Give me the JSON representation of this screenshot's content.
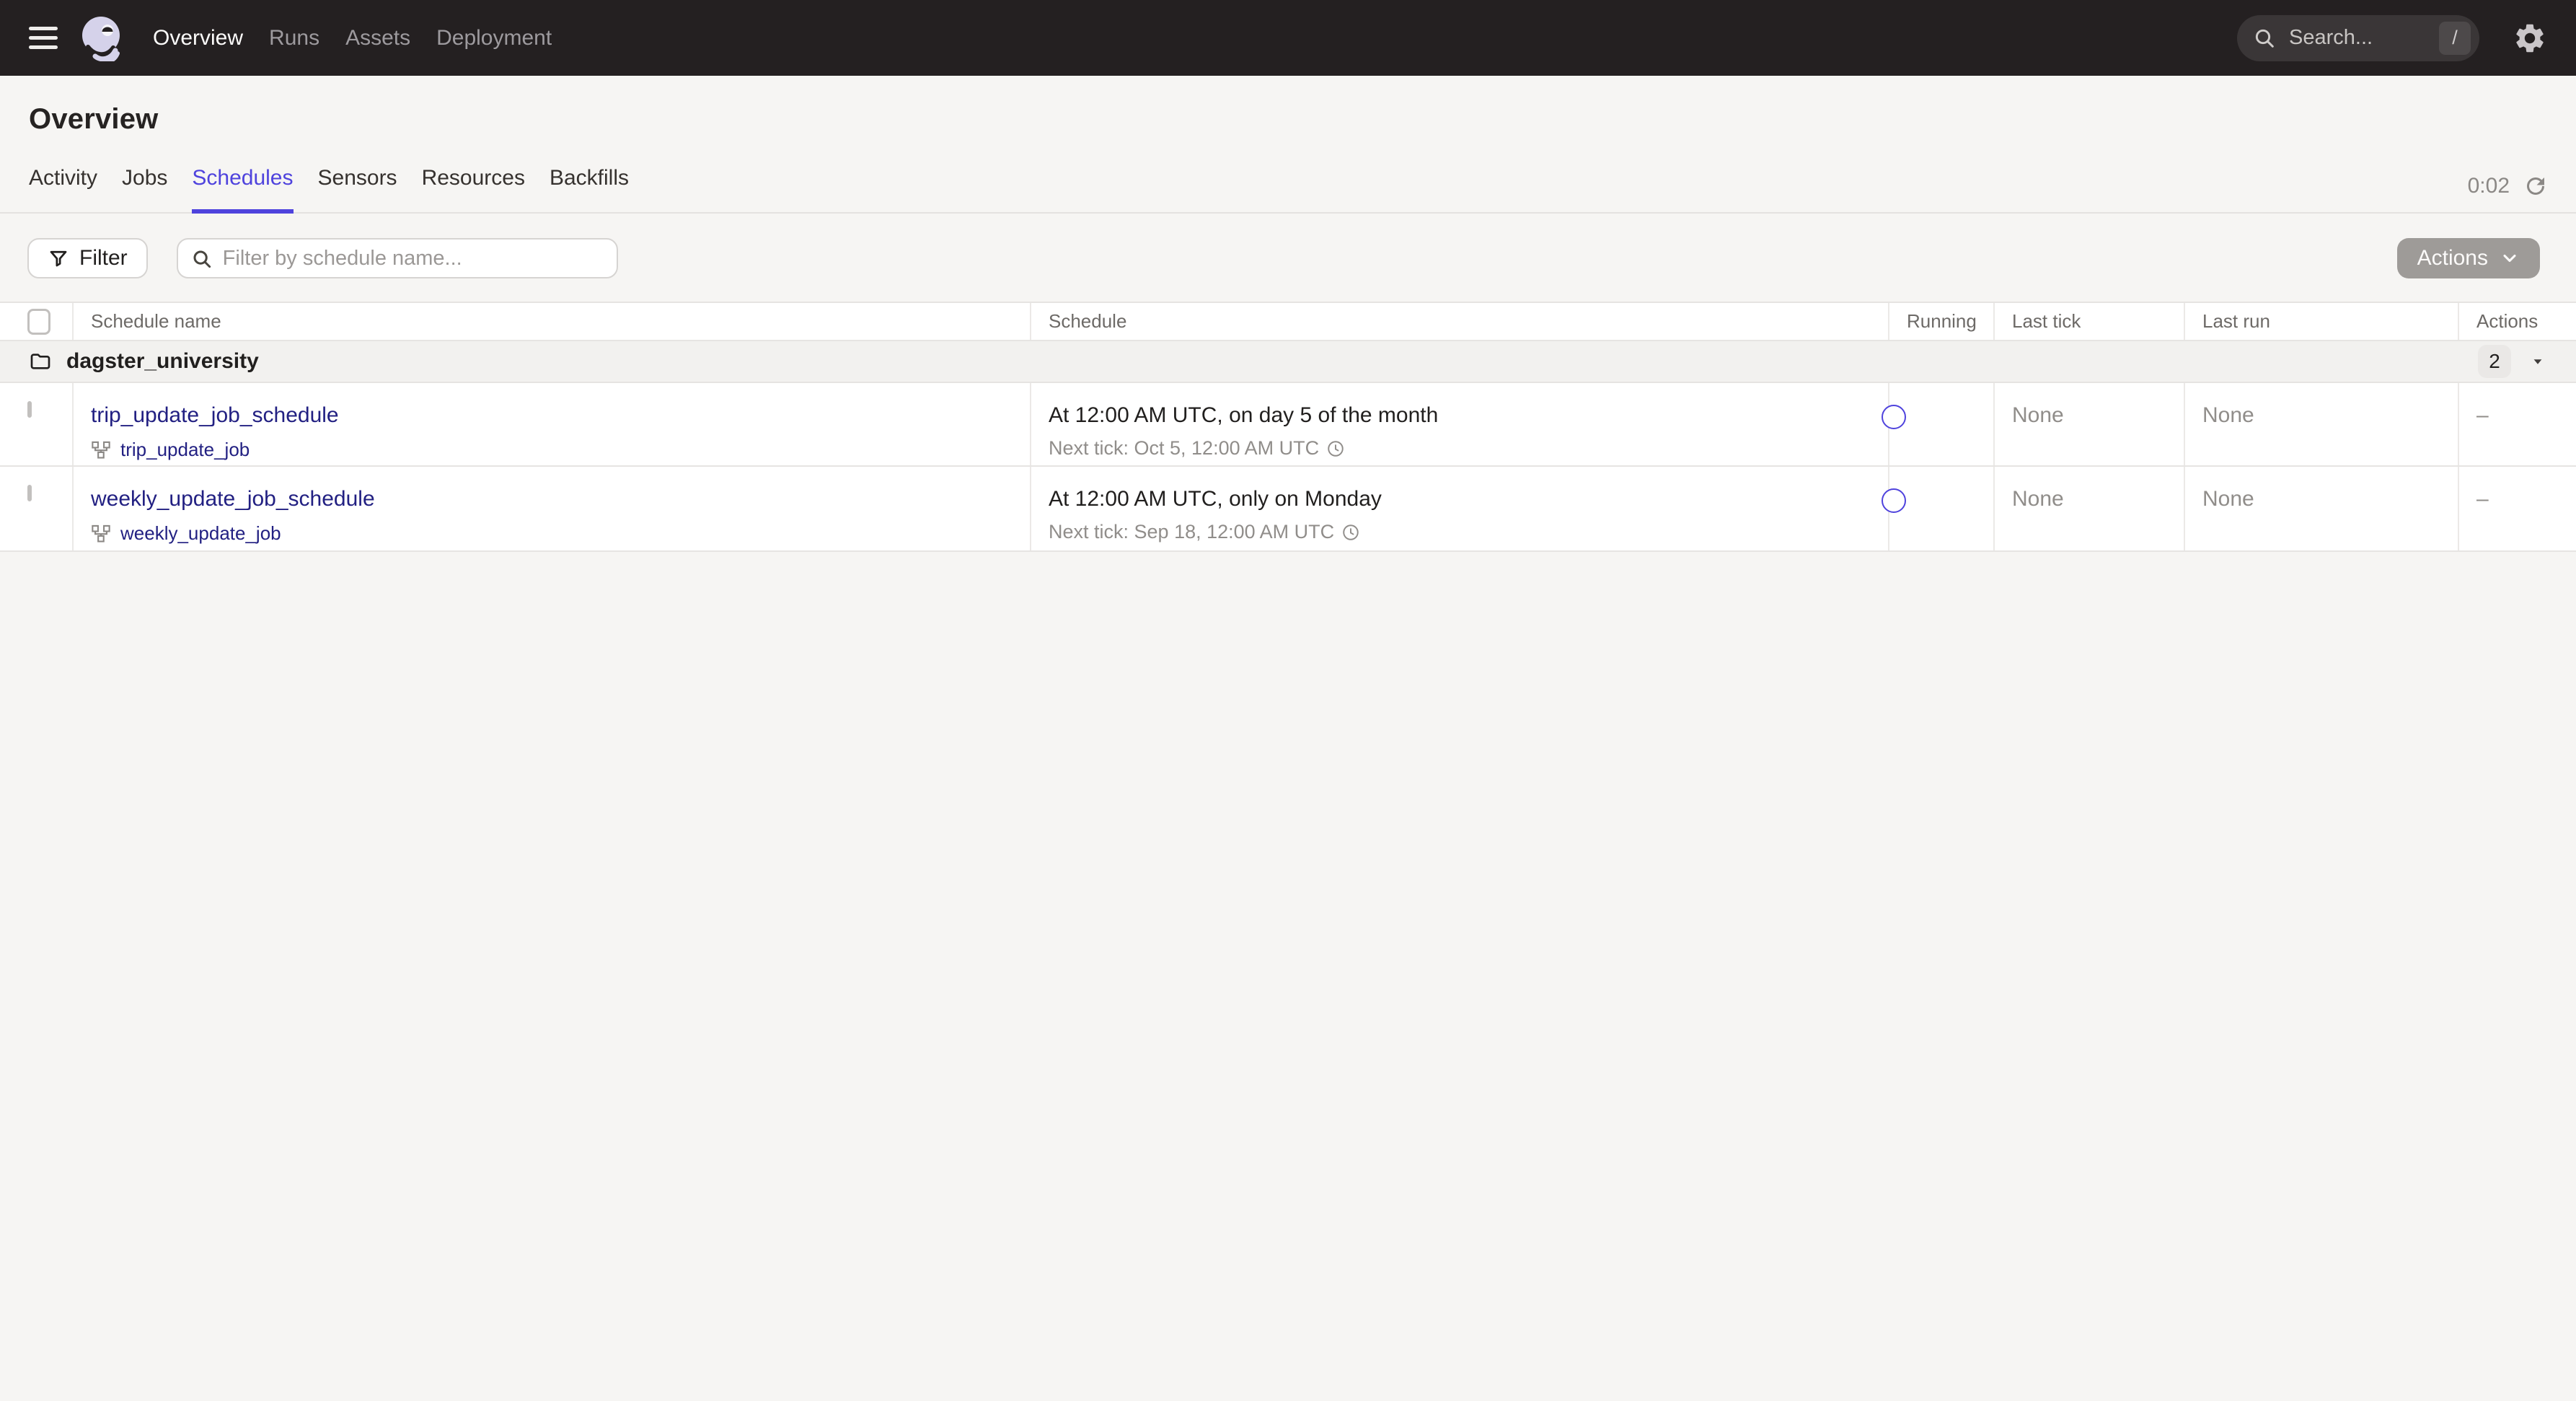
{
  "navbar": {
    "items": [
      {
        "label": "Overview",
        "active": true
      },
      {
        "label": "Runs",
        "active": false
      },
      {
        "label": "Assets",
        "active": false
      },
      {
        "label": "Deployment",
        "active": false
      }
    ],
    "search": {
      "placeholder": "Search...",
      "shortcut": "/"
    }
  },
  "page": {
    "title": "Overview"
  },
  "tabs": {
    "items": [
      {
        "label": "Activity",
        "active": false
      },
      {
        "label": "Jobs",
        "active": false
      },
      {
        "label": "Schedules",
        "active": true
      },
      {
        "label": "Sensors",
        "active": false
      },
      {
        "label": "Resources",
        "active": false
      },
      {
        "label": "Backfills",
        "active": false
      }
    ],
    "refresh_timer": "0:02"
  },
  "toolbar": {
    "filter_label": "Filter",
    "filter_placeholder": "Filter by schedule name...",
    "actions_label": "Actions"
  },
  "table": {
    "columns": [
      "Schedule name",
      "Schedule",
      "Running",
      "Last tick",
      "Last run",
      "Actions"
    ],
    "group": {
      "name": "dagster_university",
      "count": "2"
    },
    "rows": [
      {
        "name": "trip_update_job_schedule",
        "job": "trip_update_job",
        "cron": "At 12:00 AM UTC, on day 5 of the month",
        "next_tick": "Next tick: Oct 5, 12:00 AM UTC",
        "running": true,
        "last_tick": "None",
        "last_run": "None",
        "actions": "–"
      },
      {
        "name": "weekly_update_job_schedule",
        "job": "weekly_update_job",
        "cron": "At 12:00 AM UTC, only on Monday",
        "next_tick": "Next tick: Sep 18, 12:00 AM UTC",
        "running": true,
        "last_tick": "None",
        "last_run": "None",
        "actions": "–"
      }
    ]
  },
  "colors": {
    "accent": "#4F43DD",
    "link": "#222082",
    "navbar_bg": "#242021",
    "page_bg": "#F6F5F3",
    "disabled_button": "#9E9B98"
  }
}
